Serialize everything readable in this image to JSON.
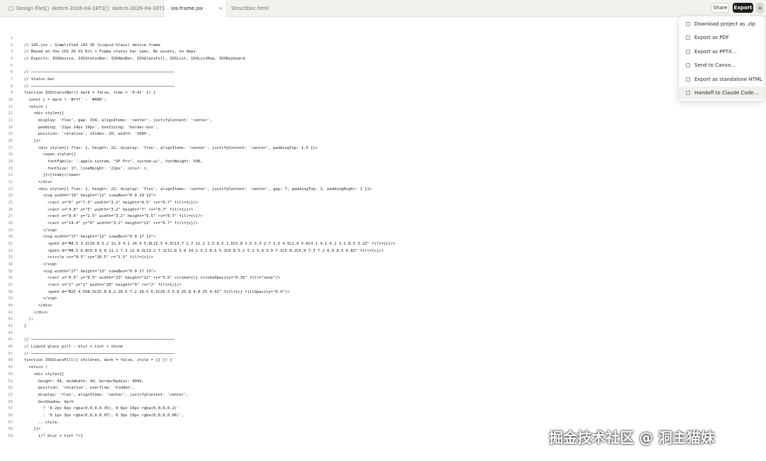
{
  "tabs": [
    {
      "label": "Design Files",
      "icon": "folder-icon",
      "active": false
    },
    {
      "label": "sketch-2026-04-18T1···",
      "icon": "sketch-icon",
      "active": false
    },
    {
      "label": "sketch-2026-04-18T1···",
      "icon": "sketch-icon",
      "active": false
    },
    {
      "label": "ios-frame.jsx",
      "icon": "",
      "active": true,
      "close": "×"
    },
    {
      "label": "StructDoc.html",
      "icon": "",
      "active": false
    }
  ],
  "toolbar": {
    "share_label": "Share",
    "export_label": "Export",
    "more_label": "≡"
  },
  "menu": [
    {
      "label": "Download project as .zip",
      "icon": "download-icon"
    },
    {
      "label": "Export as PDF",
      "icon": "pdf-icon"
    },
    {
      "label": "Export as PPTX…",
      "icon": "pptx-icon"
    },
    {
      "label": "Send to Canva…",
      "icon": "canva-icon"
    },
    {
      "label": "Export as standalone HTML",
      "icon": "html-icon"
    },
    {
      "label": "Handoff to Claude Code…",
      "icon": "terminal-icon"
    }
  ],
  "code_lines": [
    "",
    "// iOS.jsx — Simplified iOS 26 (Liquid Glass) device frame",
    "// Based on the iOS 26 UI Kit + Figma status bar spec. No assets, no deps.",
    "// Exports: IOSDevice, IOSStatusBar, IOSNavBar, IOSGlassPill, IOSList, IOSListRow, IOSKeyboard",
    "",
    "// ─────────────────────────────────────────────────────────────",
    "// Status bar",
    "// ─────────────────────────────────────────────────────────────",
    "function IOSStatusBar({ dark = false, time = '9:41' }) {",
    "  const c = dark ? '#fff' : '#000';",
    "  return (",
    "    <div style={{",
    "      display: 'flex', gap: 154, alignItems: 'center', justifyContent: 'center',",
    "      padding: '21px 24px 19px', boxSizing: 'border-box',",
    "      position: 'relative', zIndex: 20, width: '100%',",
    "    }}>",
    "      <div style={{ flex: 1, height: 22, display: 'flex', alignItems: 'center', justifyContent: 'center', paddingTop: 1.5 }}>",
    "        <span style={{",
    "          fontFamily: '-apple-system, \"SF Pro\", system-ui', fontWeight: 590,",
    "          fontSize: 17, lineHeight: '22px', color: c,",
    "        }}>{time}</span>",
    "      </div>",
    "      <div style={{ flex: 1, height: 22, display: 'flex', alignItems: 'center', justifyContent: 'center', gap: 7, paddingTop: 1, paddingRight: 1 }}>",
    "        <svg width=\"19\" height=\"12\" viewBox=\"0 0 19 12\">",
    "          <rect x=\"0\" y=\"7.5\" width=\"3.2\" height=\"4.5\" rx=\"0.7\" fill={c}/>",
    "          <rect x=\"4.8\" y=\"5\" width=\"3.2\" height=\"7\" rx=\"0.7\" fill={c}/>",
    "          <rect x=\"9.6\" y=\"2.5\" width=\"3.2\" height=\"9.5\" rx=\"0.7\" fill={c}/>",
    "          <rect x=\"14.4\" y=\"0\" width=\"3.2\" height=\"12\" rx=\"0.7\" fill={c}/>",
    "        </svg>",
    "        <svg width=\"17\" height=\"12\" viewBox=\"0 0 17 12\">",
    "          <path d=\"M8.5 3.2C10.8 3.2 12.9 4.1 14.4 5.6L15.5 4.5C13.7 2.7 11.2 1.5 8.5 1.5C5.8 1.5 3.3 2.7 1.5 4.5L2.6 5.6C4.1 4.1 6.2 3.2 8.5 3.2Z\" fill={c}/>",
    "          <path d=\"M8.5 6.8C9.9 6.8 11.1 7.3 12 8.2L13.1 7.1C11.8 5.9 10.2 5.1 8.5 5.1C6.8 5.1 5.2 5.9 3.9 7.1L5 8.2C5.9 7.3 7.1 6.8 8.5 6.8Z\" fill={c}/>",
    "          <circle cx=\"8.5\" cy=\"10.5\" r=\"1.5\" fill={c}/>",
    "        </svg>",
    "        <svg width=\"27\" height=\"13\" viewBox=\"0 0 27 13\">",
    "          <rect x=\"0.5\" y=\"0.5\" width=\"23\" height=\"12\" rx=\"3.5\" stroke={c} strokeOpacity=\"0.35\" fill=\"none\"/>",
    "          <rect x=\"2\" y=\"2\" width=\"20\" height=\"9\" rx=\"2\" fill={c}/>",
    "          <path d=\"M25 4.5V8.5C25.8 8.2 26.5 7.2 26.5 6.5C26.5 5.8 25.8 4.8 25 4.5Z\" fill={c} fillOpacity=\"0.4\"/>",
    "        </svg>",
    "      </div>",
    "    </div>",
    "  );",
    "}",
    "",
    "// ─────────────────────────────────────────────────────────────",
    "// Liquid glass pill — blur + tint + shine",
    "// ─────────────────────────────────────────────────────────────",
    "function IOSGlassPill({ children, dark = false, style = {} }) {",
    "  return (",
    "    <div style={{",
    "      height: 44, minWidth: 44, borderRadius: 9999,",
    "      position: 'relative', overflow: 'hidden',",
    "      display: 'flex', alignItems: 'center', justifyContent: 'center',",
    "      boxShadow: dark",
    "        ? '0 2px 6px rgba(0,0,0,0.35), 0 6px 16px rgba(0,0,0,0.2)'",
    "        : '0 1px 3px rgba(0,0,0,0.07), 0 3px 10px rgba(0,0,0,0.06)',",
    "      ...style,",
    "    }}>",
    "      {/* blur + tint */}"
  ],
  "watermark": "掘金技术社区 @ 洞主猫妹"
}
